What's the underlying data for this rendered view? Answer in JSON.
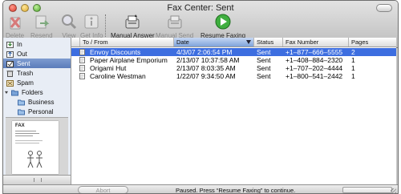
{
  "window": {
    "title": "Fax Center: Sent"
  },
  "toolbar": [
    {
      "label": "Delete",
      "icon": "delete-icon",
      "enabled": false
    },
    {
      "label": "Resend",
      "icon": "resend-icon",
      "enabled": false
    },
    {
      "label": "View",
      "icon": "view-icon",
      "enabled": false
    },
    {
      "label": "Get Info",
      "icon": "info-icon",
      "enabled": false
    },
    {
      "label": "Manual Answer",
      "icon": "manual-answer-icon",
      "enabled": true
    },
    {
      "label": "Manual Send",
      "icon": "manual-send-icon",
      "enabled": false
    },
    {
      "label": "Resume Faxing",
      "icon": "resume-faxing-icon",
      "enabled": true
    }
  ],
  "sidebar": {
    "items": [
      {
        "label": "In",
        "icon": "inbox-icon"
      },
      {
        "label": "Out",
        "icon": "outbox-icon"
      },
      {
        "label": "Sent",
        "icon": "sent-icon",
        "selected": true
      },
      {
        "label": "Trash",
        "icon": "trash-icon"
      },
      {
        "label": "Spam",
        "icon": "spam-icon"
      },
      {
        "label": "Folders",
        "icon": "folders-icon"
      },
      {
        "label": "Business",
        "icon": "folder-icon"
      },
      {
        "label": "Personal",
        "icon": "folder-icon"
      }
    ],
    "preview_heading": "FAX"
  },
  "table": {
    "columns": [
      "To / From",
      "Date",
      "Status",
      "Fax Number",
      "Pages"
    ],
    "sorted_column": "Date",
    "rows": [
      {
        "to": "Envoy Discounts",
        "date": "4/3/07 2:06:54 PM",
        "status": "Sent",
        "fax": "+1–877–666–5555",
        "pages": "2",
        "selected": true
      },
      {
        "to": "Paper Airplane Emporium",
        "date": "2/13/07 10:37:58 AM",
        "status": "Sent",
        "fax": "+1–408–884–2320",
        "pages": "1"
      },
      {
        "to": "Origami Hut",
        "date": "2/13/07 8:03:35 AM",
        "status": "Sent",
        "fax": "+1–707–202–4444",
        "pages": "1"
      },
      {
        "to": "Caroline Westman",
        "date": "1/22/07 9:34:50 AM",
        "status": "Sent",
        "fax": "+1–800–541–2442",
        "pages": "1"
      }
    ]
  },
  "status": {
    "abort_label": "Abort",
    "message": "Paused. Press “Resume Faxing” to continue."
  },
  "colors": {
    "selection": "#3d6ee0",
    "sidebar_selection": "#5b7cba",
    "sidebar_bg": "#e8edf5"
  }
}
